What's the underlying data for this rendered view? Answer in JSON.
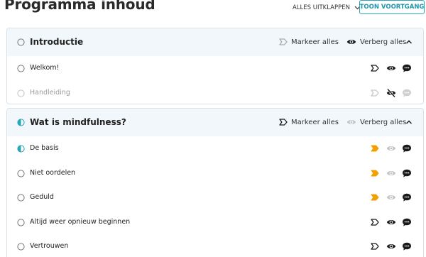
{
  "header": {
    "title": "Programma inhoud",
    "collapse_all_label": "ALLES UITKLAPPEN",
    "show_progress_label": "TOON VOORTGANG"
  },
  "colors": {
    "accent": "#2aa5b8",
    "orange": "#f0a000",
    "section_bg": "#f1f7fa",
    "muted": "#c4c4c4"
  },
  "sections": [
    {
      "title": "Introductie",
      "status": "empty",
      "mark_all_label": "Markeer alles",
      "hide_all_label": "Verberg alles",
      "rows": [
        {
          "label": "Welkom!",
          "status": "empty",
          "mark": "outline",
          "visibility": "visible",
          "comment": "active"
        },
        {
          "label": "Handleiding",
          "status": "empty",
          "mark": "outline-muted",
          "visibility": "hidden",
          "comment": "muted"
        }
      ]
    },
    {
      "title": "Wat is mindfulness?",
      "status": "half",
      "mark_all_label": "Markeer alles",
      "hide_all_label": "Verberg alles",
      "rows": [
        {
          "label": "De basis",
          "status": "half",
          "mark": "filled",
          "visibility": "visible-muted",
          "comment": "active"
        },
        {
          "label": "Niet oordelen",
          "status": "empty",
          "mark": "filled",
          "visibility": "visible-muted",
          "comment": "active"
        },
        {
          "label": "Geduld",
          "status": "empty",
          "mark": "filled",
          "visibility": "visible-muted",
          "comment": "active"
        },
        {
          "label": "Altijd weer opnieuw beginnen",
          "status": "empty",
          "mark": "outline",
          "visibility": "visible",
          "comment": "active"
        },
        {
          "label": "Vertrouwen",
          "status": "empty",
          "mark": "outline",
          "visibility": "visible",
          "comment": "active"
        }
      ]
    }
  ]
}
